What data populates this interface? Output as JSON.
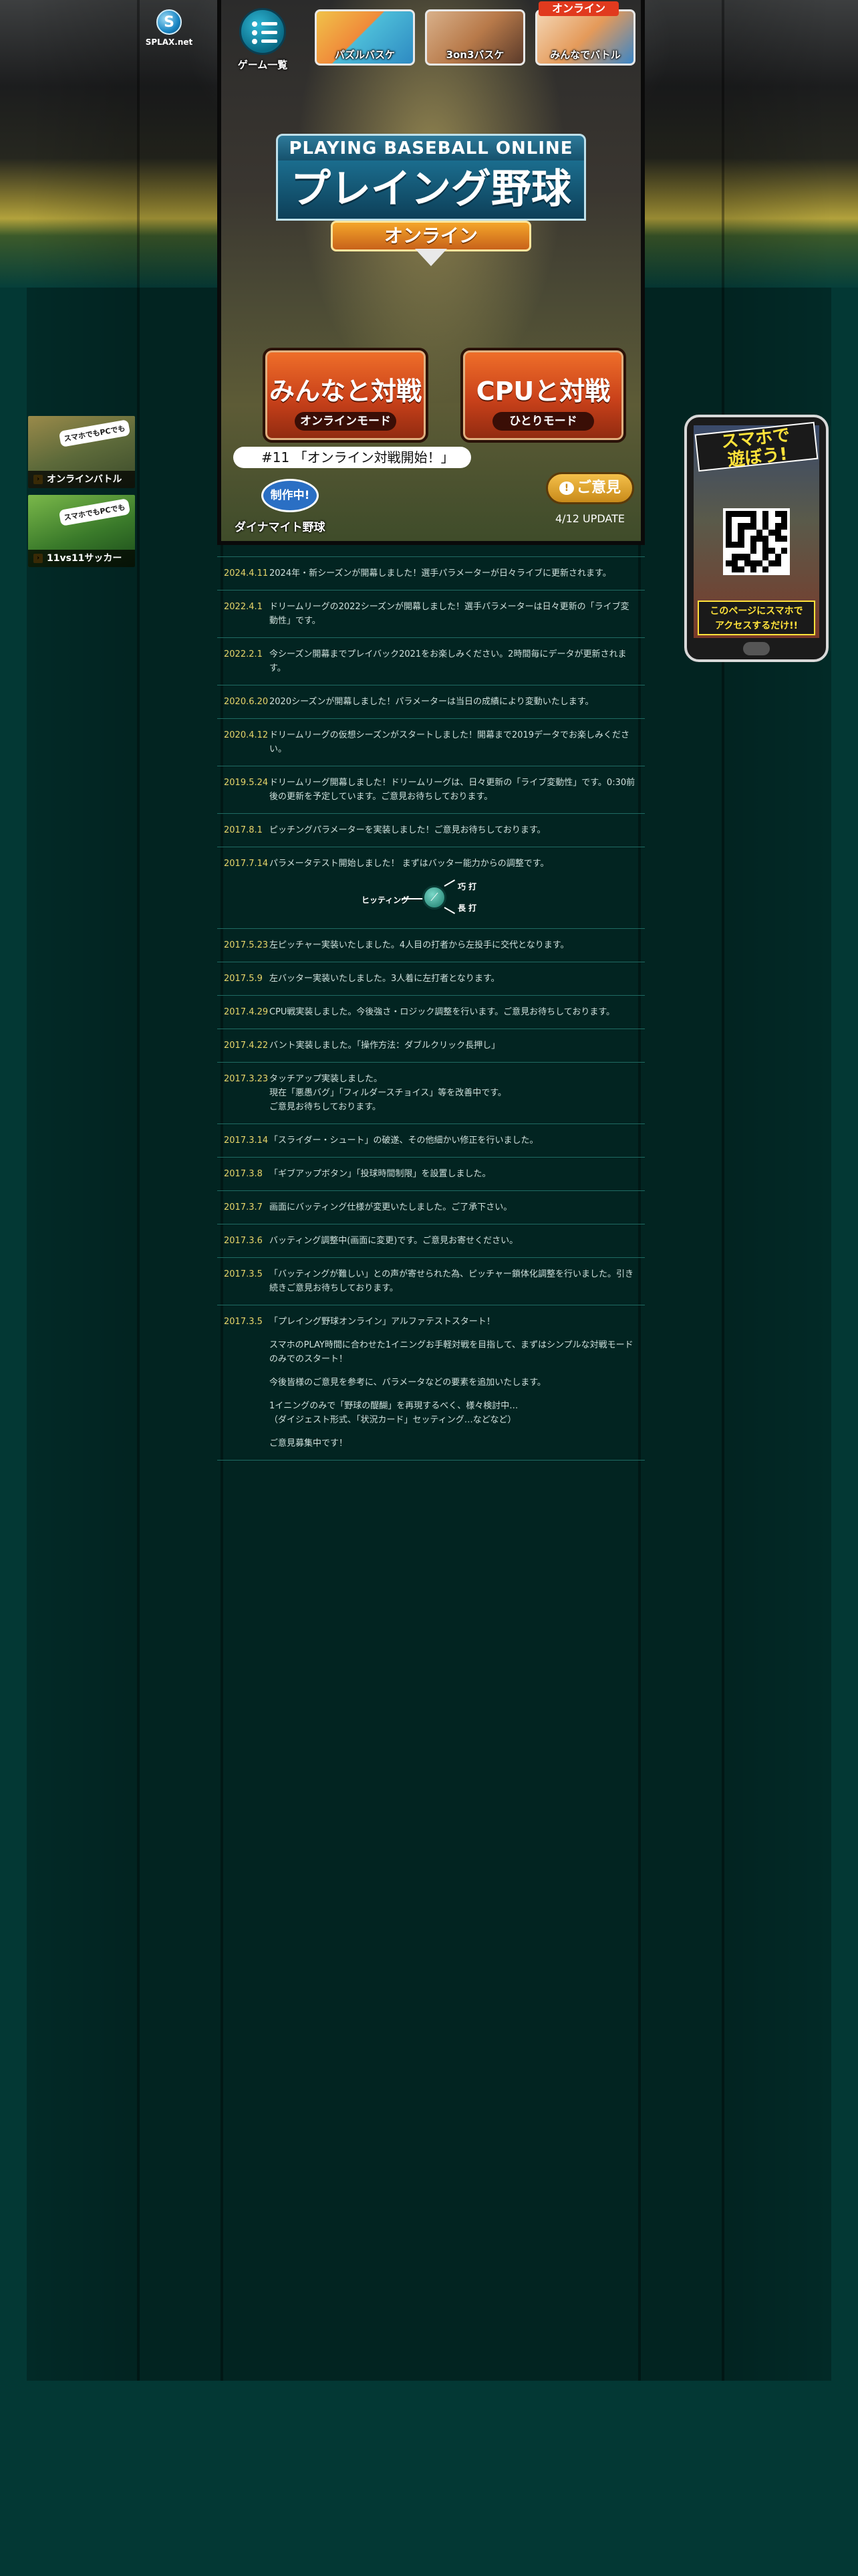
{
  "logo": {
    "text": "SPLAX.net"
  },
  "nav": {
    "game_list_label": "ゲーム一覧",
    "games": [
      {
        "label": "パズルバスケ"
      },
      {
        "label": "3on3バスケ"
      },
      {
        "label": "みんなでバトル",
        "tag": "オンライン"
      }
    ]
  },
  "title": {
    "top": "PLAYING BASEBALL ONLINE",
    "main": "プレイング野球",
    "ribbon": "オンライン"
  },
  "modes": [
    {
      "title": "みんなと対戦",
      "sub": "オンラインモード"
    },
    {
      "title": "CPUと対戦",
      "sub": "ひとりモード"
    }
  ],
  "bubble": {
    "text": "#11 「オンライン対戦開始！」"
  },
  "making": {
    "badge": "制作中!",
    "label": "ダイナマイト野球"
  },
  "feedback": {
    "label": "ご意見",
    "icon": "speech-bubble-icon"
  },
  "update": {
    "text": "4/12 UPDATE"
  },
  "side_banners": [
    {
      "tag": "スマホでもPCでも",
      "label": "オンラインバトル"
    },
    {
      "tag": "スマホでもPCでも",
      "label": "11vs11サッカー"
    }
  ],
  "phone": {
    "head_line1": "スマホで",
    "head_line2": "遊ぼう!",
    "foot_line1": "このページにスマホで",
    "foot_line2": "アクセスするだけ!!"
  },
  "hit_diagram": {
    "left": "ヒッティング",
    "top": "巧 打",
    "bottom": "長 打"
  },
  "news": [
    {
      "date": "2024.4.11",
      "lines": [
        "2024年・新シーズンが開幕しました！選手パラメーターが日々ライブに更新されます。"
      ]
    },
    {
      "date": "2022.4.1",
      "lines": [
        "ドリームリーグの2022シーズンが開幕しました！選手パラメーターは日々更新の「ライブ変動性」です。"
      ]
    },
    {
      "date": "2022.2.1",
      "lines": [
        "今シーズン開幕までプレイバック2021をお楽しみください。2時間毎にデータが更新されます。"
      ]
    },
    {
      "date": "2020.6.20",
      "lines": [
        "2020シーズンが開幕しました！パラメーターは当日の成績により変動いたします。"
      ]
    },
    {
      "date": "2020.4.12",
      "lines": [
        "ドリームリーグの仮想シーズンがスタートしました！開幕まで2019データでお楽しみください。"
      ]
    },
    {
      "date": "2019.5.24",
      "lines": [
        "ドリームリーグ開幕しました！ドリームリーグは、日々更新の「ライブ変動性」です。0:30前後の更新を予定しています。ご意見お待ちしております。"
      ]
    },
    {
      "date": "2017.8.1",
      "lines": [
        "ピッチングパラメーターを実装しました！ご意見お待ちしております。"
      ]
    },
    {
      "date": "2017.7.14",
      "lines": [
        "パラメータテスト開始しました！ まずはバッター能力からの調整です。"
      ],
      "diagram": true
    },
    {
      "date": "2017.5.23",
      "lines": [
        "左ピッチャー実装いたしました。4人目の打者から左投手に交代となります。"
      ]
    },
    {
      "date": "2017.5.9",
      "lines": [
        "左バッター実装いたしました。3人着に左打者となります。"
      ]
    },
    {
      "date": "2017.4.29",
      "lines": [
        "CPU戦実装しました。今後強さ・ロジック調整を行います。ご意見お待ちしております。"
      ]
    },
    {
      "date": "2017.4.22",
      "lines": [
        "バント実装しました。「操作方法：ダブルクリック長押し」"
      ]
    },
    {
      "date": "2017.3.23",
      "lines": [
        "タッチアップ実装しました。",
        "現在「悪愚バグ」「フィルダースチョイス」等を改善中です。",
        "ご意見お待ちしております。"
      ]
    },
    {
      "date": "2017.3.14",
      "lines": [
        "「スライダー・シュート」の破遂、その他細かい修正を行いました。"
      ]
    },
    {
      "date": "2017.3.8",
      "lines": [
        "「ギブアップボタン」「投球時間制限」を設置しました。"
      ]
    },
    {
      "date": "2017.3.7",
      "lines": [
        "画面にバッティング仕様が変更いたしました。ご了承下さい。"
      ]
    },
    {
      "date": "2017.3.6",
      "lines": [
        "バッティング調整中(画面に変更)です。ご意見お寄せください。"
      ]
    },
    {
      "date": "2017.3.5",
      "lines": [
        "「バッティングが難しい」との声が寄せられた為、ピッチャー鎖体化調整を行いました。引き続きご意見お待ちしております。"
      ]
    },
    {
      "date": "2017.3.5",
      "paras": [
        "「プレイング野球オンライン」アルファテストスタート！",
        "スマホのPLAY時間に合わせた1イニングお手軽対戦を目指して、まずはシンプルな対戦モードのみでのスタート！",
        "今後皆様のご意見を参考に、パラメータなどの要素を追加いたします。",
        "1イニングのみで「野球の醍醐」を再現するべく、様々検討中…\n（ダイジェスト形式、「状況カード」セッティング…などなど）",
        "ご意見募集中です！"
      ]
    }
  ]
}
